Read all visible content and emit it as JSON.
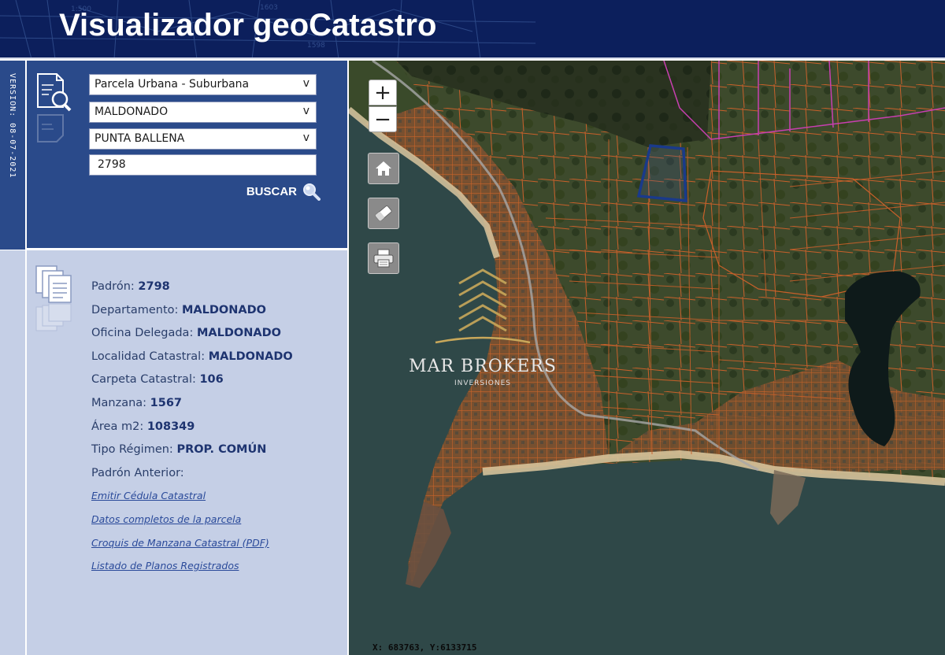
{
  "header": {
    "title": "Visualizador geoCatastro"
  },
  "version": "VERSION: 08-07-2021",
  "search": {
    "parcel_type": "Parcela Urbana - Suburbana",
    "department": "MALDONADO",
    "locality": "PUNTA BALLENA",
    "padron_value": "2798",
    "button_label": "BUSCAR"
  },
  "info": {
    "rows": [
      {
        "label": "Padrón: ",
        "value": "2798"
      },
      {
        "label": "Departamento: ",
        "value": "MALDONADO"
      },
      {
        "label": "Oficina Delegada: ",
        "value": "MALDONADO"
      },
      {
        "label": "Localidad Catastral: ",
        "value": "MALDONADO"
      },
      {
        "label": "Carpeta Catastral: ",
        "value": "106"
      },
      {
        "label": "Manzana: ",
        "value": "1567"
      },
      {
        "label": "Área m2: ",
        "value": "108349"
      },
      {
        "label": "Tipo Régimen: ",
        "value": "PROP. COMÚN"
      },
      {
        "label": "Padrón Anterior:",
        "value": ""
      }
    ],
    "links": [
      "Emitir Cédula Catastral",
      "Datos completos de la parcela",
      "Croquis de Manzana Catastral (PDF)",
      "Listado de Planos Registrados"
    ]
  },
  "map": {
    "zoom_in": "+",
    "zoom_out": "−",
    "coordinates": "X: 683763, Y:6133715",
    "watermark": "MAR  BROKERS",
    "watermark_sub": "INVERSIONES",
    "icons": [
      "home-icon",
      "eraser-icon",
      "printer-icon"
    ]
  },
  "colors": {
    "header_bg": "#0c1f5c",
    "panel_bg": "#2a4a8a",
    "info_bg": "#c5cfe6",
    "parcel_lines": "#c8602a",
    "highlight_parcel": "#1a3a8a"
  }
}
